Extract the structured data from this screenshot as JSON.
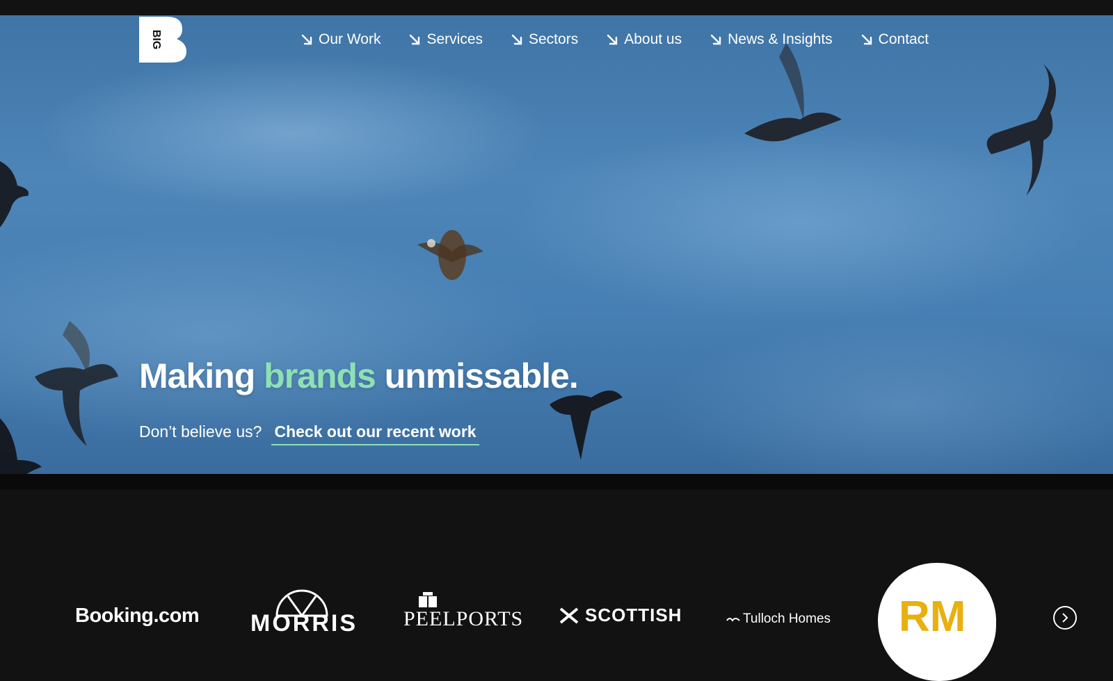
{
  "brand": {
    "logo_text": "BIG"
  },
  "nav": {
    "items": [
      {
        "label": "Our Work"
      },
      {
        "label": "Services"
      },
      {
        "label": "Sectors"
      },
      {
        "label": "About us"
      },
      {
        "label": "News & Insights"
      },
      {
        "label": "Contact"
      }
    ]
  },
  "hero": {
    "headline_part1": "Making",
    "headline_accent": "brands",
    "headline_part2": "unmissable.",
    "subline_prefix": "Don’t believe us?",
    "cta_label": "Check out our recent work"
  },
  "clients": {
    "booking": "Booking.com",
    "morris": "MORRIS",
    "peel": "PEELPORTS",
    "scottish": "SCOTTISH",
    "tulloch": "Tulloch Homes",
    "rm": "RM"
  },
  "colors": {
    "accent": "#8ee0b5",
    "background": "#121212",
    "sky": "#467fb3",
    "rm_yellow": "#e8b010"
  },
  "icons": {
    "nav_arrow": "arrow-down-right-icon",
    "carousel_next": "chevron-right-icon"
  }
}
